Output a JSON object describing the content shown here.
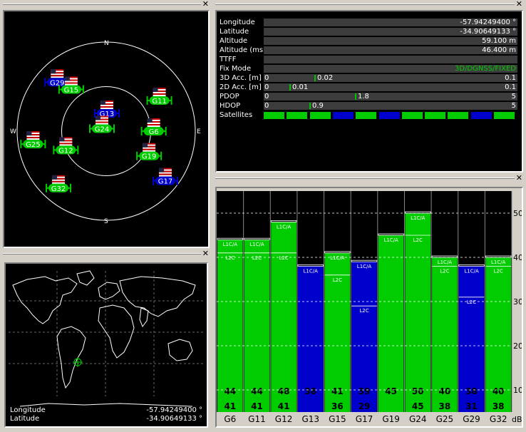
{
  "colors": {
    "green": "#00cc00",
    "blue": "#0000cc",
    "white": "#ffffff",
    "black": "#000000"
  },
  "skyplot": {
    "directions": {
      "north": "N",
      "east": "E",
      "south": "S",
      "west": "W"
    },
    "satellites": [
      {
        "id": "G13",
        "color": "blue",
        "az": 2,
        "el": 72
      },
      {
        "id": "G29",
        "color": "blue",
        "az": 315,
        "el": 20
      },
      {
        "id": "G15",
        "color": "green",
        "az": 320,
        "el": 35
      },
      {
        "id": "G11",
        "color": "green",
        "az": 60,
        "el": 28
      },
      {
        "id": "G24",
        "color": "green",
        "az": 300,
        "el": 85
      },
      {
        "id": "G6",
        "color": "green",
        "az": 90,
        "el": 42
      },
      {
        "id": "G25",
        "color": "green",
        "az": 260,
        "el": 15
      },
      {
        "id": "G12",
        "color": "green",
        "az": 245,
        "el": 45
      },
      {
        "id": "G19",
        "color": "green",
        "az": 120,
        "el": 40
      },
      {
        "id": "G32",
        "color": "green",
        "az": 220,
        "el": 15
      },
      {
        "id": "G17",
        "color": "blue",
        "az": 130,
        "el": 12
      }
    ]
  },
  "info": {
    "longitude": {
      "label": "Longitude",
      "value": "-57.94249400 °"
    },
    "latitude": {
      "label": "Latitude",
      "value": "-34.90649133 °"
    },
    "altitude": {
      "label": "Altitude",
      "value": "59.100 m"
    },
    "altitude_msl": {
      "label": "Altitude (msl)",
      "value": "46.400 m"
    },
    "ttff": {
      "label": "TTFF",
      "value": ""
    },
    "fix_mode": {
      "label": "Fix Mode",
      "value": "3D/DGNSS/FIXED"
    },
    "acc3d": {
      "label": "3D Acc. [m]",
      "min": "0",
      "max": "0.1",
      "value": "0.02",
      "fraction": 0.2
    },
    "acc2d": {
      "label": "2D Acc. [m]",
      "min": "0",
      "max": "0.1",
      "value": "0.01",
      "fraction": 0.1
    },
    "pdop": {
      "label": "PDOP",
      "min": "0",
      "max": "5",
      "value": "1.8",
      "fraction": 0.36
    },
    "hdop": {
      "label": "HDOP",
      "min": "0",
      "max": "5",
      "value": "0.9",
      "fraction": 0.18
    },
    "satellites": {
      "label": "Satellites",
      "cells": [
        "green",
        "green",
        "green",
        "blue",
        "green",
        "blue",
        "green",
        "green",
        "green",
        "blue",
        "green"
      ]
    }
  },
  "map": {
    "longitude": {
      "label": "Longitude",
      "value": "-57.94249400 °"
    },
    "latitude": {
      "label": "Latitude",
      "value": "-34.90649133 °"
    }
  },
  "chart_data": {
    "type": "bar",
    "categories": [
      "G6",
      "G11",
      "G12",
      "G13",
      "G15",
      "G17",
      "G19",
      "G24",
      "G25",
      "G29",
      "G32"
    ],
    "colors": [
      "green",
      "green",
      "green",
      "blue",
      "green",
      "blue",
      "green",
      "green",
      "green",
      "blue",
      "green"
    ],
    "series": [
      {
        "name": "L1C/A",
        "values": [
          44,
          44,
          48,
          38,
          41,
          39,
          45,
          50,
          40,
          38,
          40
        ]
      },
      {
        "name": "L2C",
        "values": [
          41,
          41,
          41,
          null,
          36,
          29,
          null,
          45,
          38,
          31,
          38
        ]
      }
    ],
    "ylim": [
      5,
      55
    ],
    "yticks": [
      10,
      20,
      30,
      40,
      50
    ],
    "yunit": "dB",
    "labels": {
      "l1": "L1C/A",
      "l2": "L2C"
    }
  }
}
